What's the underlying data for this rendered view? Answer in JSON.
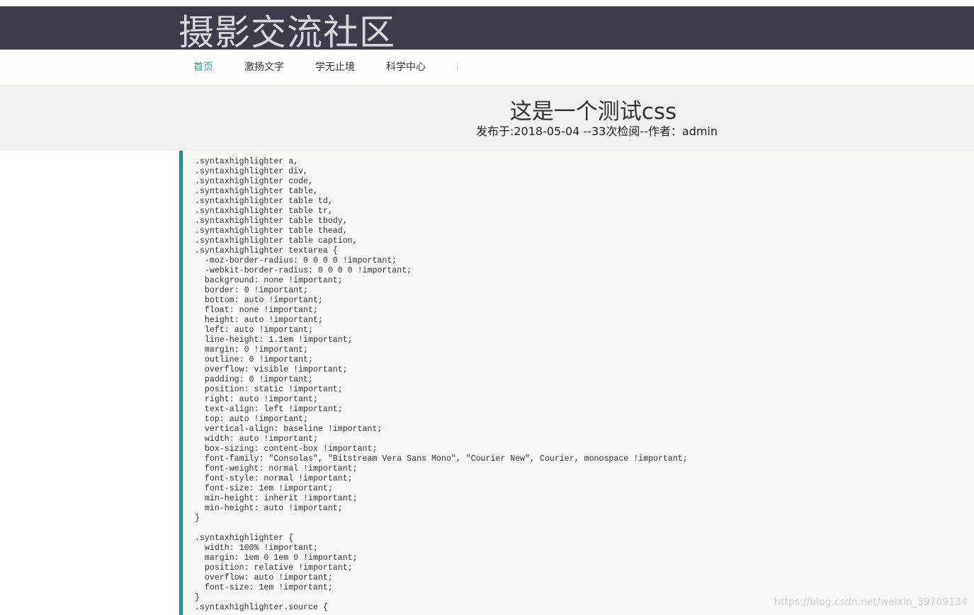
{
  "header": {
    "site_title": "摄影交流社区"
  },
  "nav": {
    "items": [
      {
        "label": "首页",
        "active": true
      },
      {
        "label": "激扬文字",
        "active": false
      },
      {
        "label": "学无止境",
        "active": false
      },
      {
        "label": "科学中心",
        "active": false
      }
    ]
  },
  "post": {
    "title": "这是一个测试css",
    "meta": "发布于:2018-05-04 --33次检阅--作者：admin"
  },
  "code": {
    "lines": [
      ".syntaxhighlighter a,",
      ".syntaxhighlighter div,",
      ".syntaxhighlighter code,",
      ".syntaxhighlighter table,",
      ".syntaxhighlighter table td,",
      ".syntaxhighlighter table tr,",
      ".syntaxhighlighter table tbody,",
      ".syntaxhighlighter table thead,",
      ".syntaxhighlighter table caption,",
      ".syntaxhighlighter textarea {",
      "  -moz-border-radius: 0 0 0 0 !important;",
      "  -webkit-border-radius: 0 0 0 0 !important;",
      "  background: none !important;",
      "  border: 0 !important;",
      "  bottom: auto !important;",
      "  float: none !important;",
      "  height: auto !important;",
      "  left: auto !important;",
      "  line-height: 1.1em !important;",
      "  margin: 0 !important;",
      "  outline: 0 !important;",
      "  overflow: visible !important;",
      "  padding: 0 !important;",
      "  position: static !important;",
      "  right: auto !important;",
      "  text-align: left !important;",
      "  top: auto !important;",
      "  vertical-align: baseline !important;",
      "  width: auto !important;",
      "  box-sizing: content-box !important;",
      "  font-family: \"Consolas\", \"Bitstream Vera Sans Mono\", \"Courier New\", Courier, monospace !important;",
      "  font-weight: normal !important;",
      "  font-style: normal !important;",
      "  font-size: 1em !important;",
      "  min-height: inherit !important;",
      "  min-height: auto !important;",
      "}",
      "",
      ".syntaxhighlighter {",
      "  width: 100% !important;",
      "  margin: 1em 0 1em 0 !important;",
      "  position: relative !important;",
      "  overflow: auto !important;",
      "  font-size: 1em !important;",
      "}",
      ".syntaxhighlighter.source {"
    ]
  },
  "watermark": "https://blog.csdn.net/weixin_39709134",
  "colors": {
    "header_bg": "#3b3d4a",
    "accent": "#2b9a93",
    "code_border": "#13969a"
  }
}
